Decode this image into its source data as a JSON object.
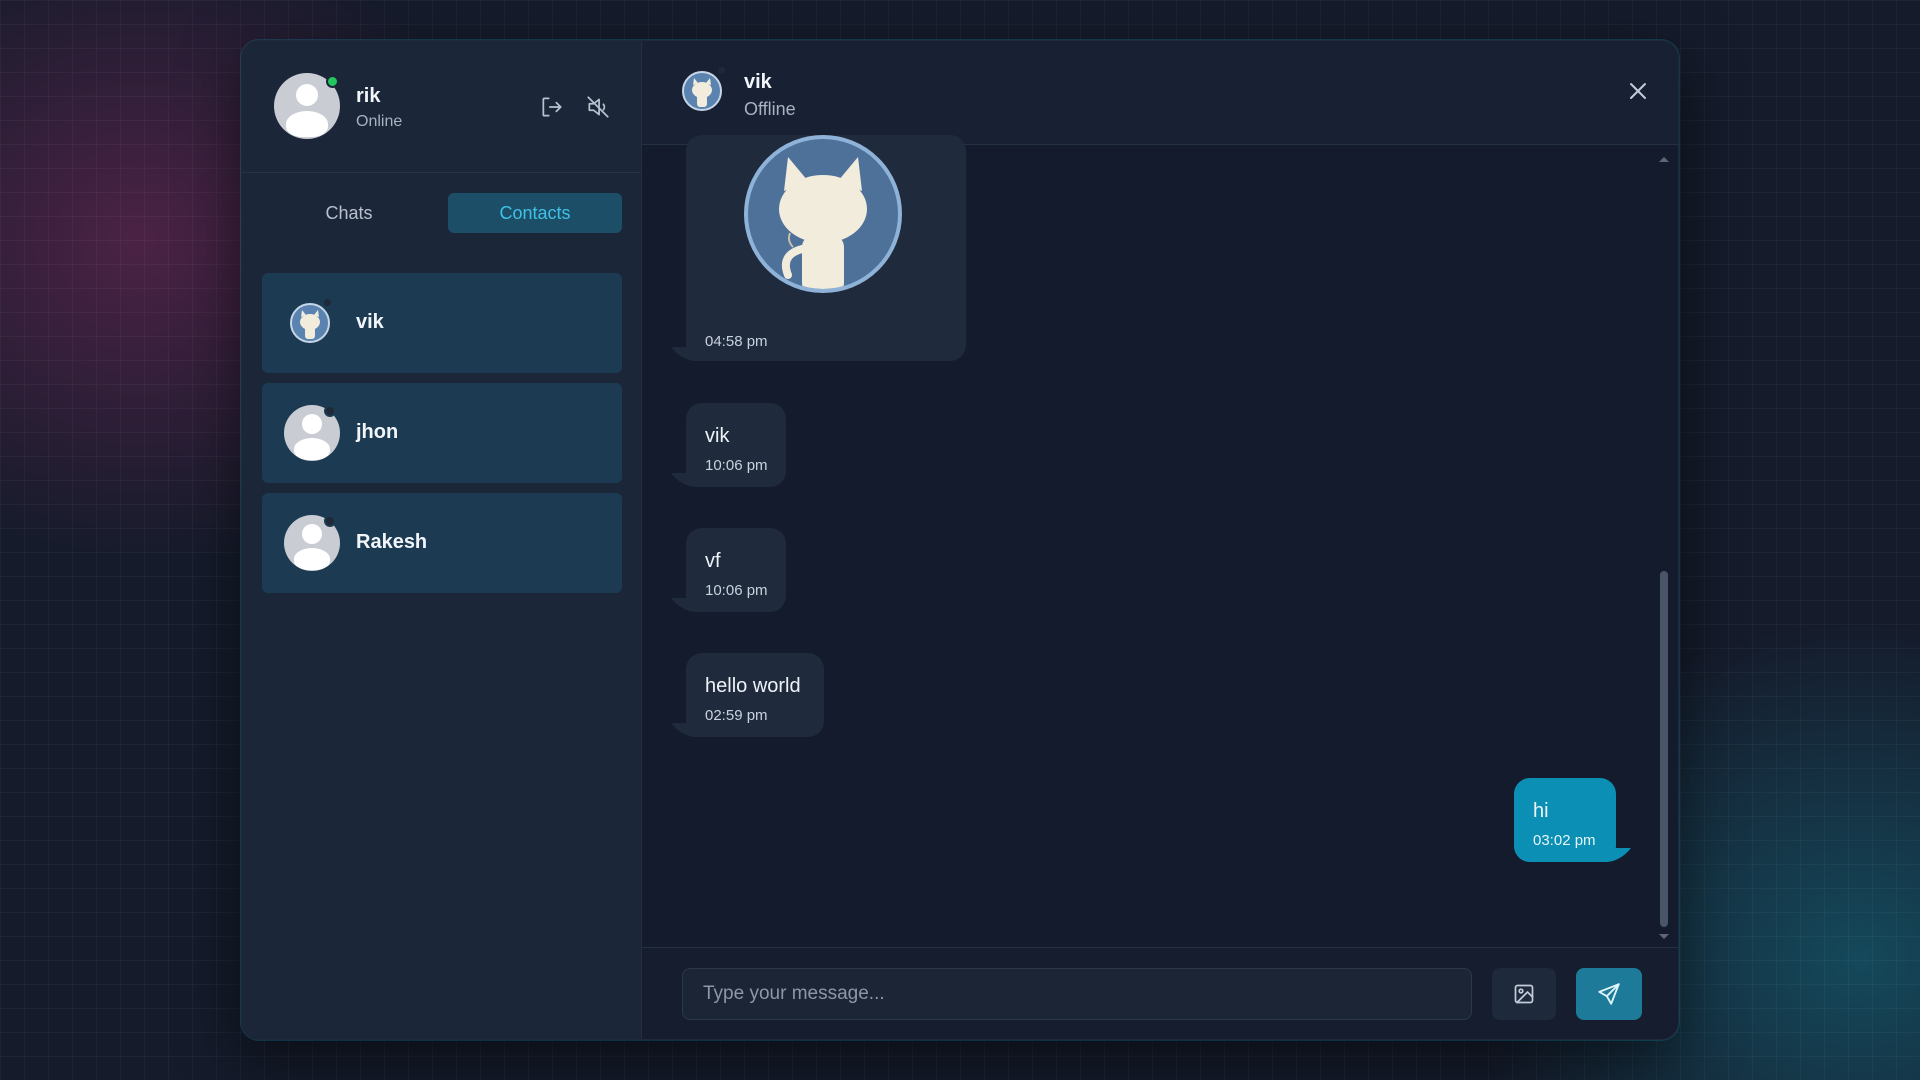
{
  "current_user": {
    "name": "rik",
    "status": "Online",
    "status_color": "#22c55e"
  },
  "header_icons": [
    "logout-icon",
    "sound-off-icon"
  ],
  "tabs": [
    {
      "label": "Chats",
      "active": false
    },
    {
      "label": "Contacts",
      "active": true
    }
  ],
  "contacts": [
    {
      "name": "vik",
      "avatar": "github-octocat-icon",
      "status_color": "#1f2937"
    },
    {
      "name": "jhon",
      "avatar": "default-user-icon",
      "status_color": "#1f2937"
    },
    {
      "name": "Rakesh",
      "avatar": "default-user-icon",
      "status_color": "#1f2937"
    }
  ],
  "chat": {
    "peer_name": "vik",
    "peer_status": "Offline",
    "messages": [
      {
        "type": "image",
        "image": "github-octocat-icon",
        "time": "04:58 pm",
        "direction": "in"
      },
      {
        "type": "text",
        "text": "vik",
        "time": "10:06 pm",
        "direction": "in"
      },
      {
        "type": "text",
        "text": "vf",
        "time": "10:06 pm",
        "direction": "in"
      },
      {
        "type": "text",
        "text": "hello world",
        "time": "02:59 pm",
        "direction": "in"
      },
      {
        "type": "text",
        "text": "hi",
        "time": "03:02 pm",
        "direction": "out"
      }
    ]
  },
  "composer": {
    "placeholder": "Type your message...",
    "value": ""
  },
  "colors": {
    "accent": "#0b8fb5",
    "tab_active_bg": "#1c4e67",
    "tab_active_text": "#3fc1e6",
    "contact_bg": "#1c3b52"
  }
}
